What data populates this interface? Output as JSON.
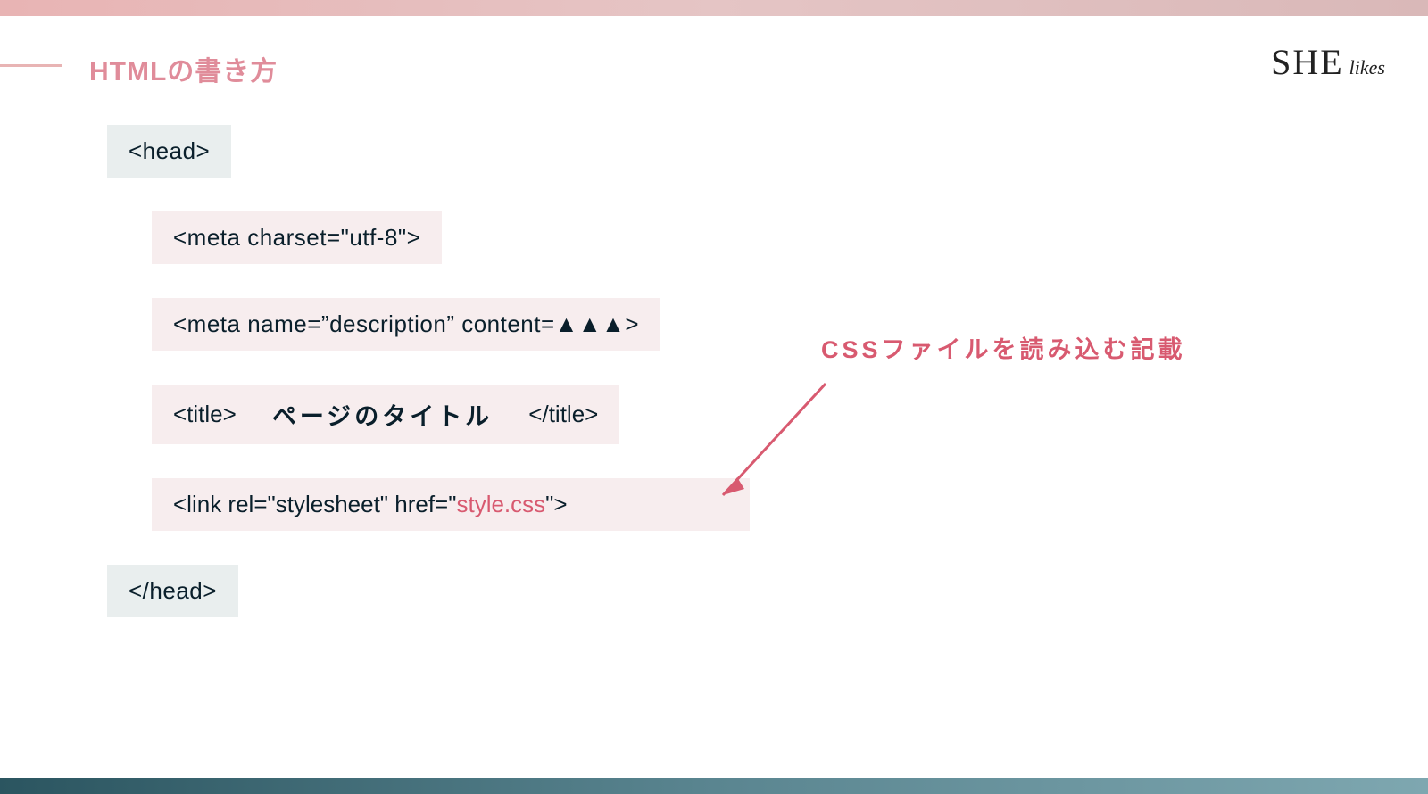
{
  "header": {
    "title": "HTMLの書き方",
    "logo_main": "SHE",
    "logo_sub": "likes"
  },
  "code": {
    "head_open": "<head>",
    "meta_charset": "<meta charset=\"utf-8\">",
    "meta_description": "<meta name=”description” content=▲▲▲>",
    "title_open": "<title>",
    "title_text": "ページのタイトル",
    "title_close": "</title>",
    "link_prefix": "<link rel=\"stylesheet\" href=\"",
    "link_file": "style.css",
    "link_suffix": "\">",
    "head_close": "</head>"
  },
  "annotation": {
    "css_note": "CSSファイルを読み込む記載"
  }
}
